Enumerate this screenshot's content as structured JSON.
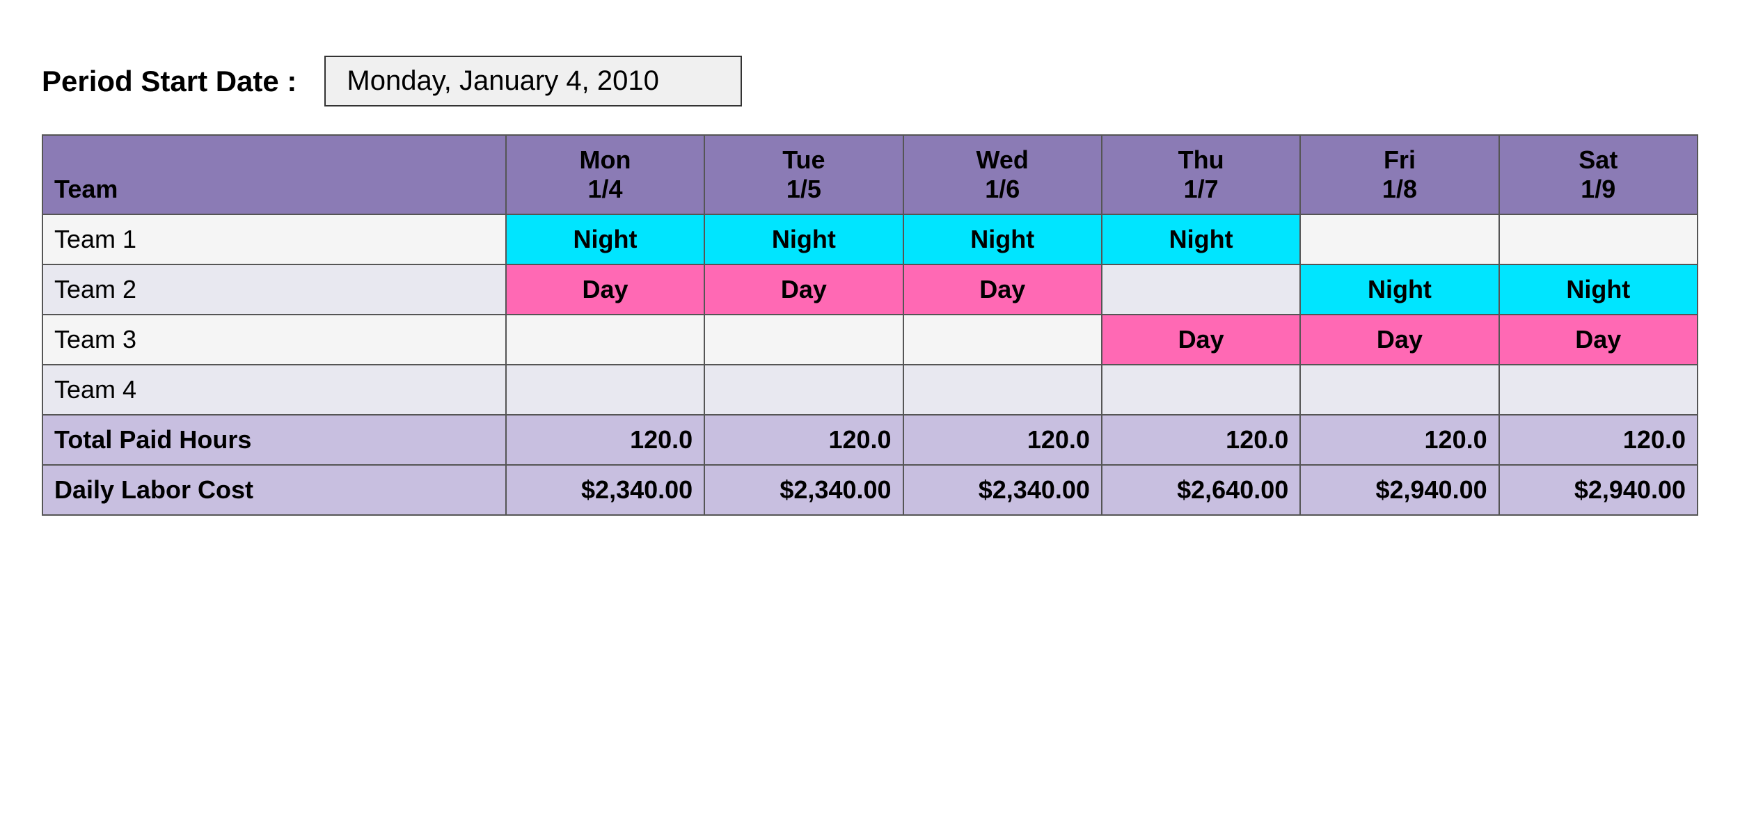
{
  "period": {
    "label": "Period Start Date :",
    "value": "Monday, January 4, 2010"
  },
  "table": {
    "columns": [
      {
        "id": "team",
        "header_line1": "Team",
        "header_line2": "",
        "class": "col-team"
      },
      {
        "id": "mon",
        "header_line1": "Mon",
        "header_line2": "1/4",
        "class": "col-day"
      },
      {
        "id": "tue",
        "header_line1": "Tue",
        "header_line2": "1/5",
        "class": "col-day"
      },
      {
        "id": "wed",
        "header_line1": "Wed",
        "header_line2": "1/6",
        "class": "col-day"
      },
      {
        "id": "thu",
        "header_line1": "Thu",
        "header_line2": "1/7",
        "class": "col-day"
      },
      {
        "id": "fri",
        "header_line1": "Fri",
        "header_line2": "1/8",
        "class": "col-day"
      },
      {
        "id": "sat",
        "header_line1": "Sat",
        "header_line2": "1/9",
        "class": "col-day"
      }
    ],
    "teams": [
      {
        "name": "Team 1",
        "row_class": "row-team1",
        "shifts": {
          "mon": {
            "label": "Night",
            "type": "night"
          },
          "tue": {
            "label": "Night",
            "type": "night"
          },
          "wed": {
            "label": "Night",
            "type": "night"
          },
          "thu": {
            "label": "Night",
            "type": "night"
          },
          "fri": {
            "label": "",
            "type": ""
          },
          "sat": {
            "label": "",
            "type": ""
          }
        }
      },
      {
        "name": "Team 2",
        "row_class": "row-team2",
        "shifts": {
          "mon": {
            "label": "Day",
            "type": "day"
          },
          "tue": {
            "label": "Day",
            "type": "day"
          },
          "wed": {
            "label": "Day",
            "type": "day"
          },
          "thu": {
            "label": "",
            "type": ""
          },
          "fri": {
            "label": "Night",
            "type": "night"
          },
          "sat": {
            "label": "Night",
            "type": "night"
          }
        }
      },
      {
        "name": "Team 3",
        "row_class": "row-team3",
        "shifts": {
          "mon": {
            "label": "",
            "type": ""
          },
          "tue": {
            "label": "",
            "type": ""
          },
          "wed": {
            "label": "",
            "type": ""
          },
          "thu": {
            "label": "Day",
            "type": "day"
          },
          "fri": {
            "label": "Day",
            "type": "day"
          },
          "sat": {
            "label": "Day",
            "type": "day"
          }
        }
      },
      {
        "name": "Team 4",
        "row_class": "row-team4",
        "shifts": {
          "mon": {
            "label": "",
            "type": ""
          },
          "tue": {
            "label": "",
            "type": ""
          },
          "wed": {
            "label": "",
            "type": ""
          },
          "thu": {
            "label": "",
            "type": ""
          },
          "fri": {
            "label": "",
            "type": ""
          },
          "sat": {
            "label": "",
            "type": ""
          }
        }
      }
    ],
    "summary_rows": [
      {
        "label": "Total Paid Hours",
        "values": {
          "mon": "120.0",
          "tue": "120.0",
          "wed": "120.0",
          "thu": "120.0",
          "fri": "120.0",
          "sat": "120.0"
        }
      },
      {
        "label": "Daily Labor Cost",
        "values": {
          "mon": "$2,340.00",
          "tue": "$2,340.00",
          "wed": "$2,340.00",
          "thu": "$2,640.00",
          "fri": "$2,940.00",
          "sat": "$2,940.00"
        }
      }
    ]
  }
}
